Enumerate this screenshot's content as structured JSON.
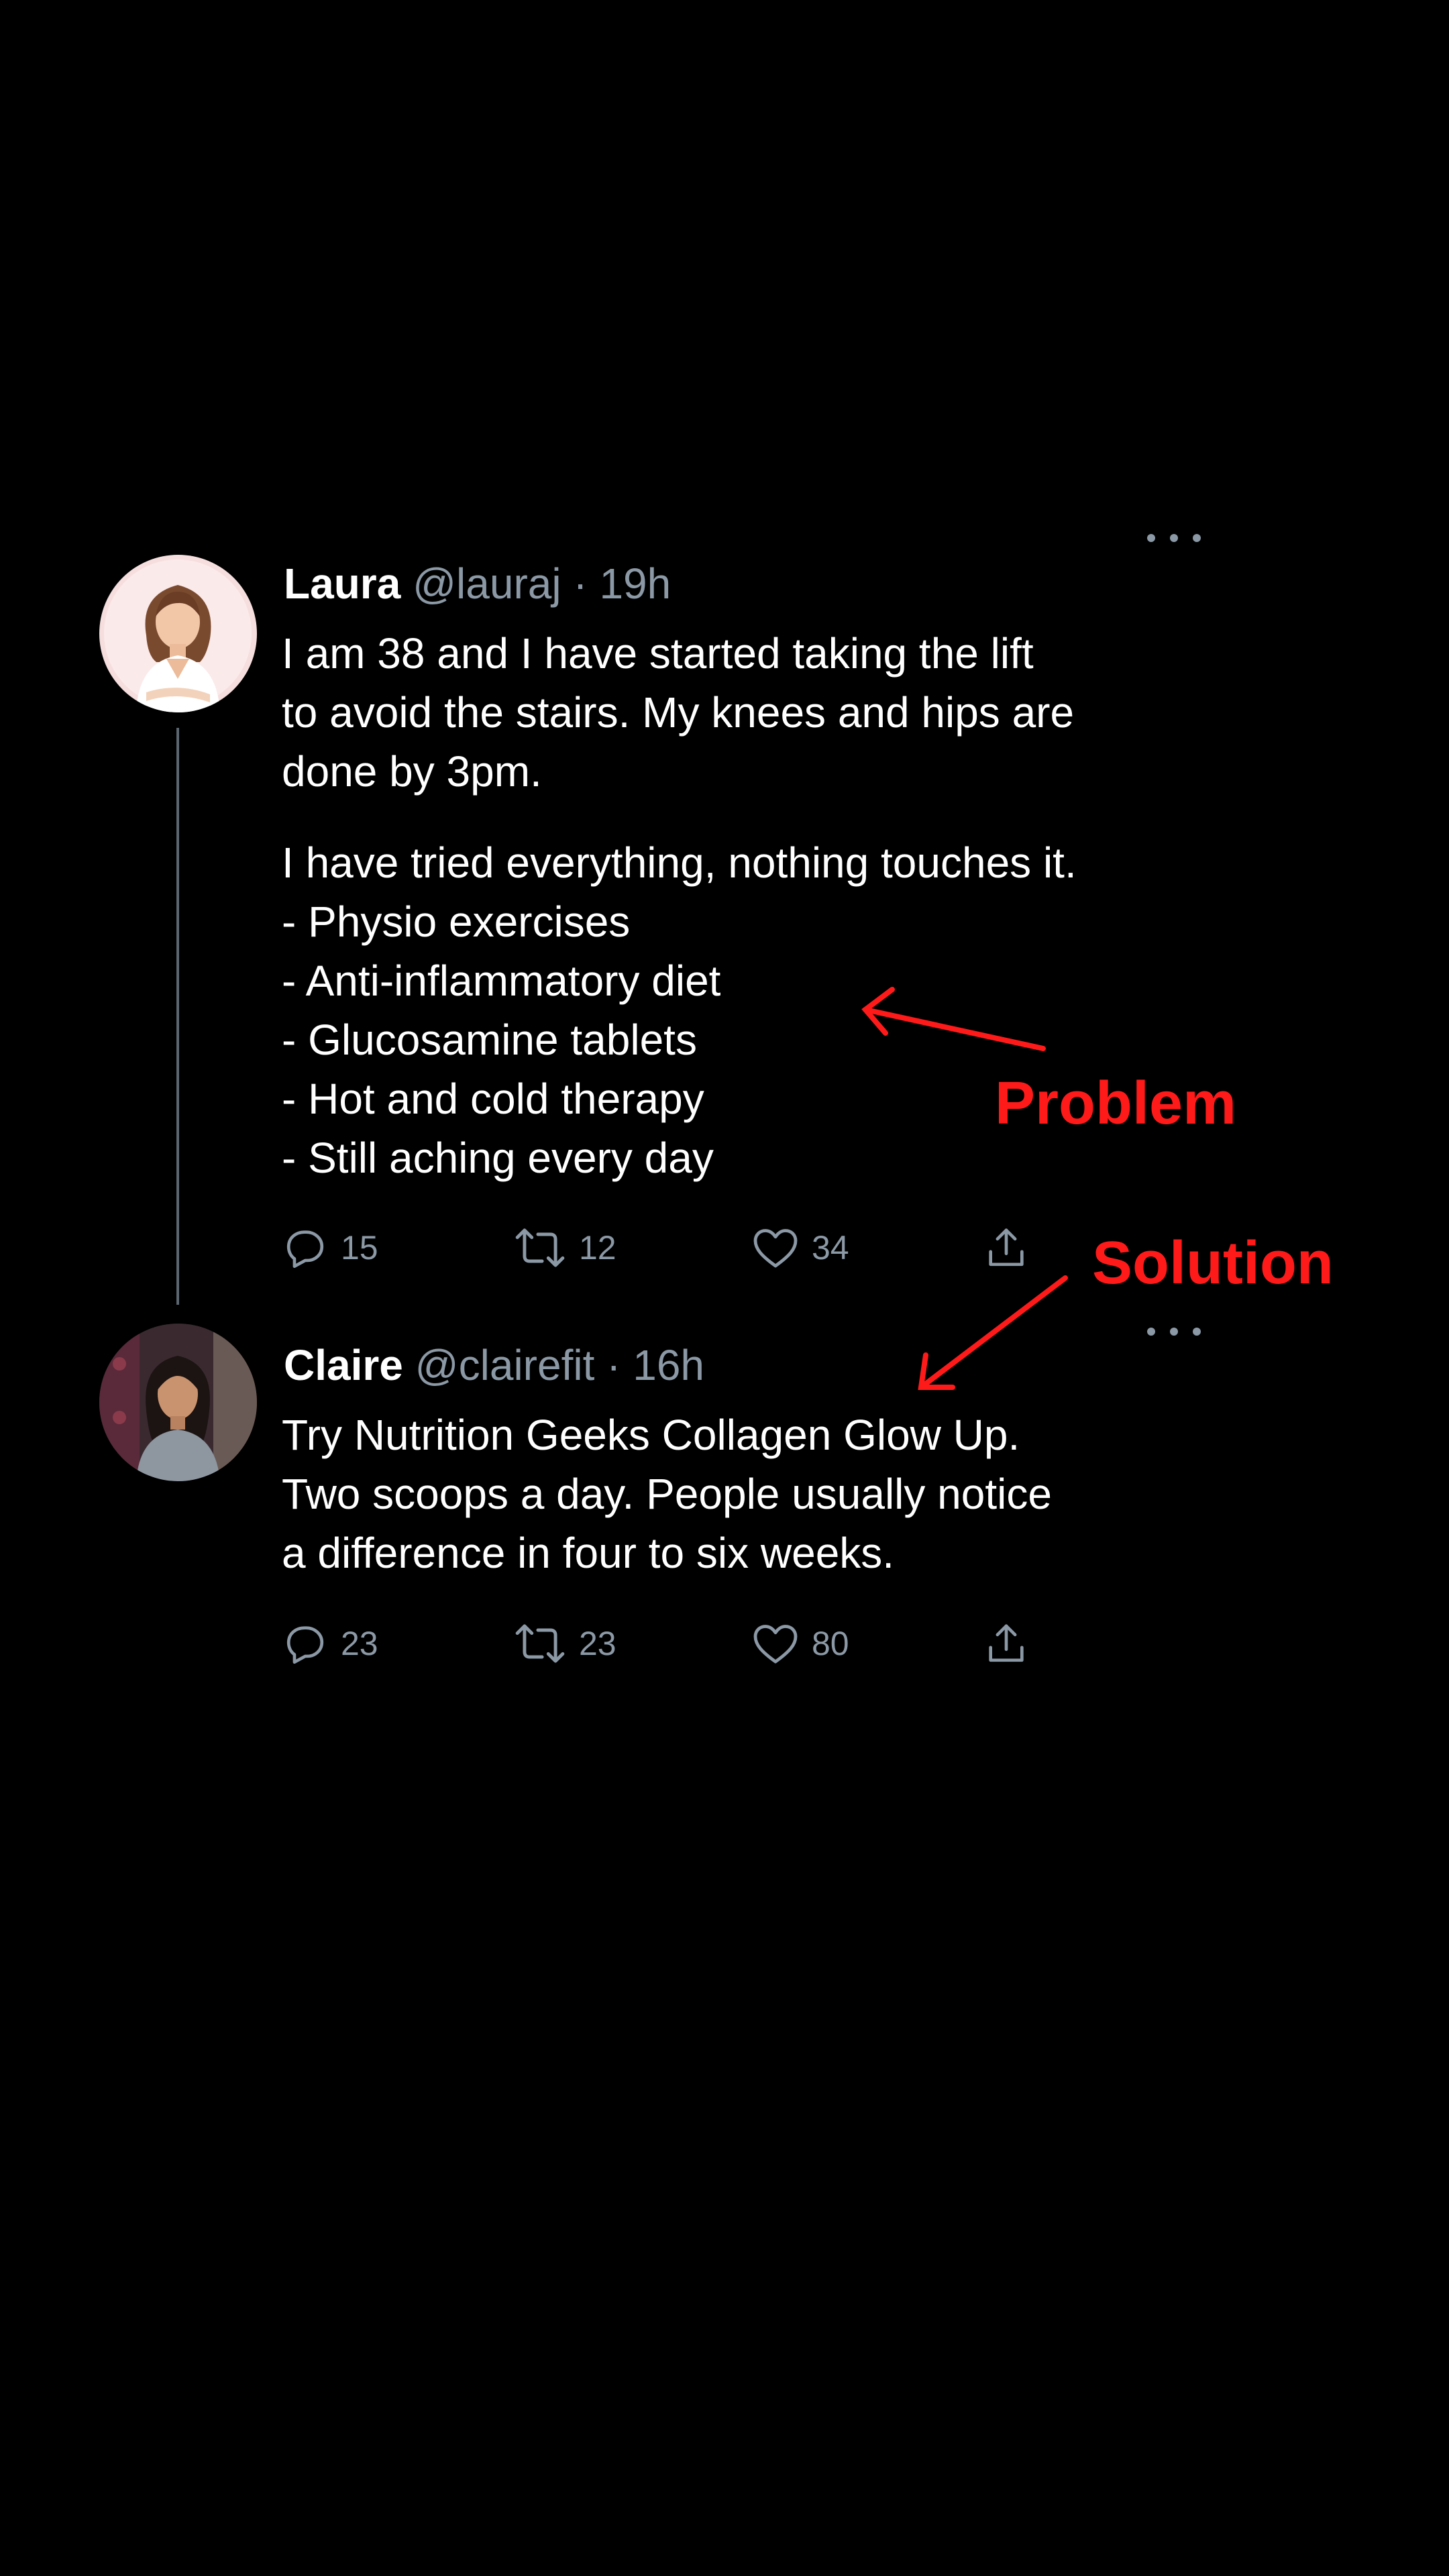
{
  "colors": {
    "background": "#000000",
    "text": "#ffffff",
    "muted": "#8b98a5",
    "annotation": "#ff1a1a"
  },
  "tweets": [
    {
      "name": "Laura",
      "handle": "@lauraj",
      "time": "19h",
      "separator": "·",
      "lines_1": [
        "I am 38 and I have started taking the lift",
        "to avoid the stairs. My knees and hips are",
        "done by 3pm."
      ],
      "lines_2": [
        "I have tried everything, nothing touches it.",
        "- Physio exercises",
        "- Anti-inflammatory diet",
        "- Glucosamine tablets",
        "- Hot and cold therapy",
        "- Still aching every day"
      ],
      "replies": "15",
      "retweets": "12",
      "likes": "34",
      "icons": [
        "reply-icon",
        "retweet-icon",
        "like-icon",
        "share-icon",
        "more-icon"
      ]
    },
    {
      "name": "Claire",
      "handle": "@clairefit",
      "time": "16h",
      "separator": "·",
      "lines_1": [
        "Try Nutrition Geeks Collagen Glow Up.",
        "Two scoops a day. People usually notice",
        "a difference in four to six weeks."
      ],
      "replies": "23",
      "retweets": "23",
      "likes": "80",
      "icons": [
        "reply-icon",
        "retweet-icon",
        "like-icon",
        "share-icon",
        "more-icon"
      ]
    }
  ],
  "annotations": {
    "problem": "Problem",
    "solution": "Solution"
  }
}
